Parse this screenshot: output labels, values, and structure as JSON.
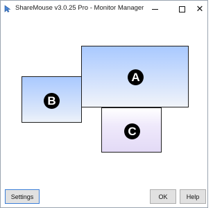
{
  "window": {
    "title": "ShareMouse v3.0.25 Pro - Monitor Manager",
    "icons": {
      "app": "sharemouse-app-icon",
      "minimize": "minimize-icon",
      "maximize": "maximize-icon",
      "close": "close-icon"
    },
    "close_glyph": "✕"
  },
  "monitors": [
    {
      "label": "A",
      "gradient": [
        "#a9c9ff",
        "#f1f4fa"
      ]
    },
    {
      "label": "B",
      "gradient": [
        "#a9c9ff",
        "#eef3fa"
      ]
    },
    {
      "label": "C",
      "gradient": [
        "#ffffff",
        "#e3daf6"
      ]
    }
  ],
  "buttons": {
    "settings": "Settings",
    "ok": "OK",
    "help": "Help"
  },
  "colors": {
    "badge_bg": "#000000",
    "badge_text": "#ffffff",
    "focus_border": "#3c7fd8"
  }
}
